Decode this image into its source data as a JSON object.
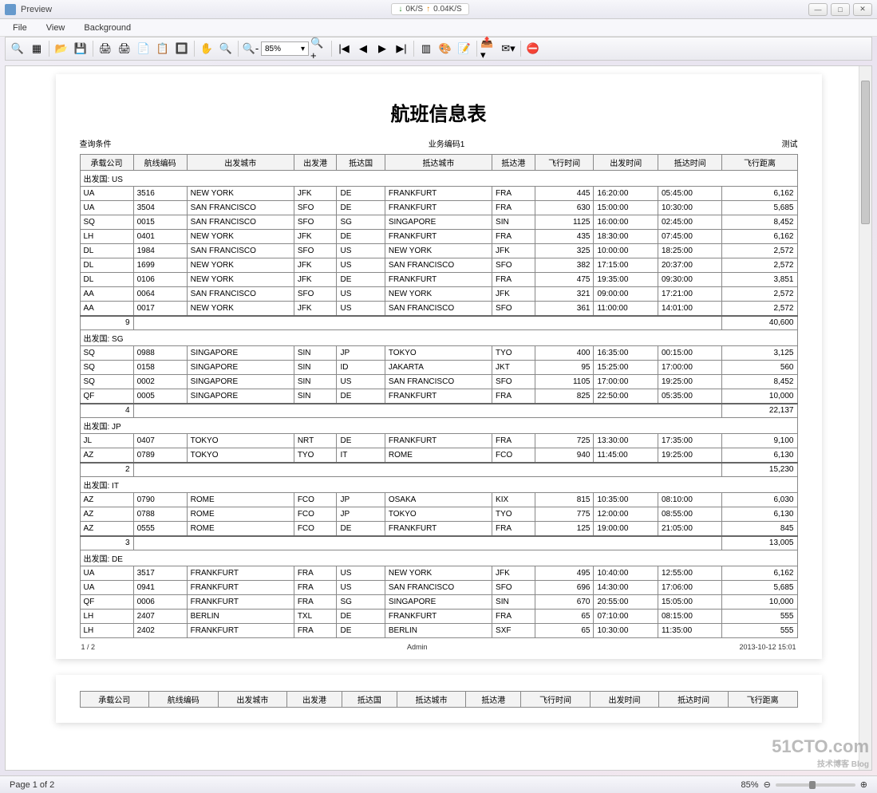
{
  "window": {
    "title": "Preview"
  },
  "speed": {
    "down": "0K/S",
    "up": "0.04K/S"
  },
  "menus": {
    "file": "File",
    "view": "View",
    "background": "Background"
  },
  "toolbar": {
    "zoom_value": "85%"
  },
  "statusbar": {
    "page_of": "Page 1 of 2",
    "zoom": "85%"
  },
  "doc": {
    "title": "航班信息表",
    "left_sub": "查询条件",
    "mid_sub": "业务编码1",
    "right_sub": "测试",
    "footer_page": "1 / 2",
    "footer_user": "Admin",
    "footer_time": "2013-10-12   15:01"
  },
  "headers": [
    "承载公司",
    "航线编码",
    "出发城市",
    "出发港",
    "抵达国",
    "抵达城市",
    "抵达港",
    "飞行时间",
    "出发时间",
    "抵达时间",
    "飞行距离"
  ],
  "groups": [
    {
      "label": "出发国: US",
      "rows": [
        [
          "UA",
          "3516",
          "NEW YORK",
          "JFK",
          "DE",
          "FRANKFURT",
          "FRA",
          "445",
          "16:20:00",
          "05:45:00",
          "6,162"
        ],
        [
          "UA",
          "3504",
          "SAN FRANCISCO",
          "SFO",
          "DE",
          "FRANKFURT",
          "FRA",
          "630",
          "15:00:00",
          "10:30:00",
          "5,685"
        ],
        [
          "SQ",
          "0015",
          "SAN FRANCISCO",
          "SFO",
          "SG",
          "SINGAPORE",
          "SIN",
          "1125",
          "16:00:00",
          "02:45:00",
          "8,452"
        ],
        [
          "LH",
          "0401",
          "NEW YORK",
          "JFK",
          "DE",
          "FRANKFURT",
          "FRA",
          "435",
          "18:30:00",
          "07:45:00",
          "6,162"
        ],
        [
          "DL",
          "1984",
          "SAN FRANCISCO",
          "SFO",
          "US",
          "NEW YORK",
          "JFK",
          "325",
          "10:00:00",
          "18:25:00",
          "2,572"
        ],
        [
          "DL",
          "1699",
          "NEW YORK",
          "JFK",
          "US",
          "SAN FRANCISCO",
          "SFO",
          "382",
          "17:15:00",
          "20:37:00",
          "2,572"
        ],
        [
          "DL",
          "0106",
          "NEW YORK",
          "JFK",
          "DE",
          "FRANKFURT",
          "FRA",
          "475",
          "19:35:00",
          "09:30:00",
          "3,851"
        ],
        [
          "AA",
          "0064",
          "SAN FRANCISCO",
          "SFO",
          "US",
          "NEW YORK",
          "JFK",
          "321",
          "09:00:00",
          "17:21:00",
          "2,572"
        ],
        [
          "AA",
          "0017",
          "NEW YORK",
          "JFK",
          "US",
          "SAN FRANCISCO",
          "SFO",
          "361",
          "11:00:00",
          "14:01:00",
          "2,572"
        ]
      ],
      "count": "9",
      "total": "40,600"
    },
    {
      "label": "出发国: SG",
      "rows": [
        [
          "SQ",
          "0988",
          "SINGAPORE",
          "SIN",
          "JP",
          "TOKYO",
          "TYO",
          "400",
          "16:35:00",
          "00:15:00",
          "3,125"
        ],
        [
          "SQ",
          "0158",
          "SINGAPORE",
          "SIN",
          "ID",
          "JAKARTA",
          "JKT",
          "95",
          "15:25:00",
          "17:00:00",
          "560"
        ],
        [
          "SQ",
          "0002",
          "SINGAPORE",
          "SIN",
          "US",
          "SAN FRANCISCO",
          "SFO",
          "1105",
          "17:00:00",
          "19:25:00",
          "8,452"
        ],
        [
          "QF",
          "0005",
          "SINGAPORE",
          "SIN",
          "DE",
          "FRANKFURT",
          "FRA",
          "825",
          "22:50:00",
          "05:35:00",
          "10,000"
        ]
      ],
      "count": "4",
      "total": "22,137"
    },
    {
      "label": "出发国: JP",
      "rows": [
        [
          "JL",
          "0407",
          "TOKYO",
          "NRT",
          "DE",
          "FRANKFURT",
          "FRA",
          "725",
          "13:30:00",
          "17:35:00",
          "9,100"
        ],
        [
          "AZ",
          "0789",
          "TOKYO",
          "TYO",
          "IT",
          "ROME",
          "FCO",
          "940",
          "11:45:00",
          "19:25:00",
          "6,130"
        ]
      ],
      "count": "2",
      "total": "15,230"
    },
    {
      "label": "出发国: IT",
      "rows": [
        [
          "AZ",
          "0790",
          "ROME",
          "FCO",
          "JP",
          "OSAKA",
          "KIX",
          "815",
          "10:35:00",
          "08:10:00",
          "6,030"
        ],
        [
          "AZ",
          "0788",
          "ROME",
          "FCO",
          "JP",
          "TOKYO",
          "TYO",
          "775",
          "12:00:00",
          "08:55:00",
          "6,130"
        ],
        [
          "AZ",
          "0555",
          "ROME",
          "FCO",
          "DE",
          "FRANKFURT",
          "FRA",
          "125",
          "19:00:00",
          "21:05:00",
          "845"
        ]
      ],
      "count": "3",
      "total": "13,005"
    },
    {
      "label": "出发国: DE",
      "rows": [
        [
          "UA",
          "3517",
          "FRANKFURT",
          "FRA",
          "US",
          "NEW YORK",
          "JFK",
          "495",
          "10:40:00",
          "12:55:00",
          "6,162"
        ],
        [
          "UA",
          "0941",
          "FRANKFURT",
          "FRA",
          "US",
          "SAN FRANCISCO",
          "SFO",
          "696",
          "14:30:00",
          "17:06:00",
          "5,685"
        ],
        [
          "QF",
          "0006",
          "FRANKFURT",
          "FRA",
          "SG",
          "SINGAPORE",
          "SIN",
          "670",
          "20:55:00",
          "15:05:00",
          "10,000"
        ],
        [
          "LH",
          "2407",
          "BERLIN",
          "TXL",
          "DE",
          "FRANKFURT",
          "FRA",
          "65",
          "07:10:00",
          "08:15:00",
          "555"
        ],
        [
          "LH",
          "2402",
          "FRANKFURT",
          "FRA",
          "DE",
          "BERLIN",
          "SXF",
          "65",
          "10:30:00",
          "11:35:00",
          "555"
        ]
      ],
      "count": "",
      "total": ""
    }
  ],
  "watermark": {
    "main": "51CTO.com",
    "sub": "技术博客  Blog"
  }
}
